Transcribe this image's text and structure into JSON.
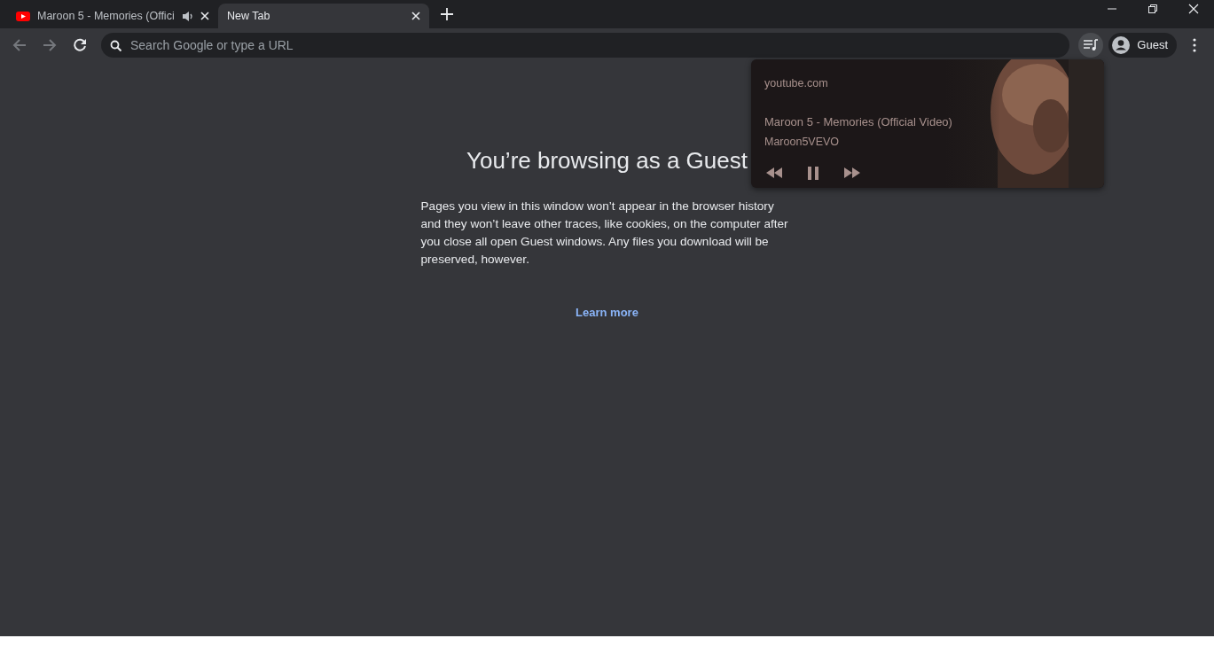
{
  "tabs": [
    {
      "title": "Maroon 5 - Memories (Offici",
      "selected": false,
      "audio": true,
      "kind": "video"
    },
    {
      "title": "New Tab",
      "selected": true,
      "audio": false,
      "kind": "blank"
    }
  ],
  "omnibox": {
    "placeholder": "Search Google or type a URL"
  },
  "profile": {
    "label": "Guest"
  },
  "page": {
    "heading": "You’re browsing as a Guest",
    "body": "Pages you view in this window won’t appear in the browser history and they won’t leave other traces, like cookies, on the computer after you close all open Guest windows. Any files you download will be preserved, however.",
    "link": "Learn more"
  },
  "media": {
    "source": "youtube.com",
    "title": "Maroon 5 - Memories (Official Video)",
    "artist": "Maroon5VEVO",
    "playing": true
  }
}
